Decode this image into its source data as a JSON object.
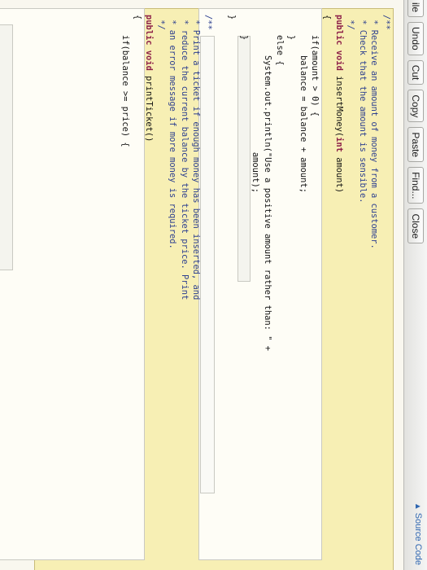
{
  "toolbar": {
    "buttons": [
      "ile",
      "Undo",
      "Cut",
      "Copy",
      "Paste",
      "Find...",
      "Close"
    ],
    "view_selector": "Source Code"
  },
  "code_lines": [
    [
      {
        "t": "/**",
        "c": "cm"
      }
    ],
    [
      {
        "t": " * Receive an amount of money from a customer.",
        "c": "cm"
      }
    ],
    [
      {
        "t": " * Check that the amount is sensible.",
        "c": "cm"
      }
    ],
    [
      {
        "t": " */",
        "c": "cm"
      }
    ],
    [
      {
        "t": "public ",
        "c": "kw"
      },
      {
        "t": "void ",
        "c": "kw"
      },
      {
        "t": "insertMoney(",
        "c": "pl"
      },
      {
        "t": "int ",
        "c": "kw"
      },
      {
        "t": "amount)",
        "c": "pl"
      }
    ],
    [
      {
        "t": "{",
        "c": "pl"
      }
    ],
    [
      {
        "t": "    if(amount > 0) {",
        "c": "pl"
      }
    ],
    [
      {
        "t": "        balance = balance + amount;",
        "c": "pl"
      }
    ],
    [
      {
        "t": "    }",
        "c": "pl"
      }
    ],
    [
      {
        "t": "    else {",
        "c": "pl"
      }
    ],
    [
      {
        "t": "        System.out.println(\"Use a positive amount rather than: \" +",
        "c": "pl"
      }
    ],
    [
      {
        "t": "                           amount);",
        "c": "pl"
      }
    ],
    [
      {
        "t": "    }",
        "c": "pl"
      }
    ],
    [
      {
        "t": "}",
        "c": "pl"
      }
    ],
    [
      {
        "t": "",
        "c": "pl"
      }
    ],
    [
      {
        "t": "/**",
        "c": "cm"
      }
    ],
    [
      {
        "t": " * Print a ticket if enough money has been inserted, and",
        "c": "cm"
      }
    ],
    [
      {
        "t": " * reduce the current balance by the ticket price. Print",
        "c": "cm"
      }
    ],
    [
      {
        "t": " * an error message if more money is required.",
        "c": "cm"
      }
    ],
    [
      {
        "t": " */",
        "c": "cm"
      }
    ],
    [
      {
        "t": "public ",
        "c": "kw"
      },
      {
        "t": "void ",
        "c": "kw"
      },
      {
        "t": "printTicket()",
        "c": "pl"
      }
    ],
    [
      {
        "t": "{",
        "c": "pl"
      }
    ],
    [
      {
        "t": "    if(balance >= price) {",
        "c": "pl"
      }
    ]
  ]
}
